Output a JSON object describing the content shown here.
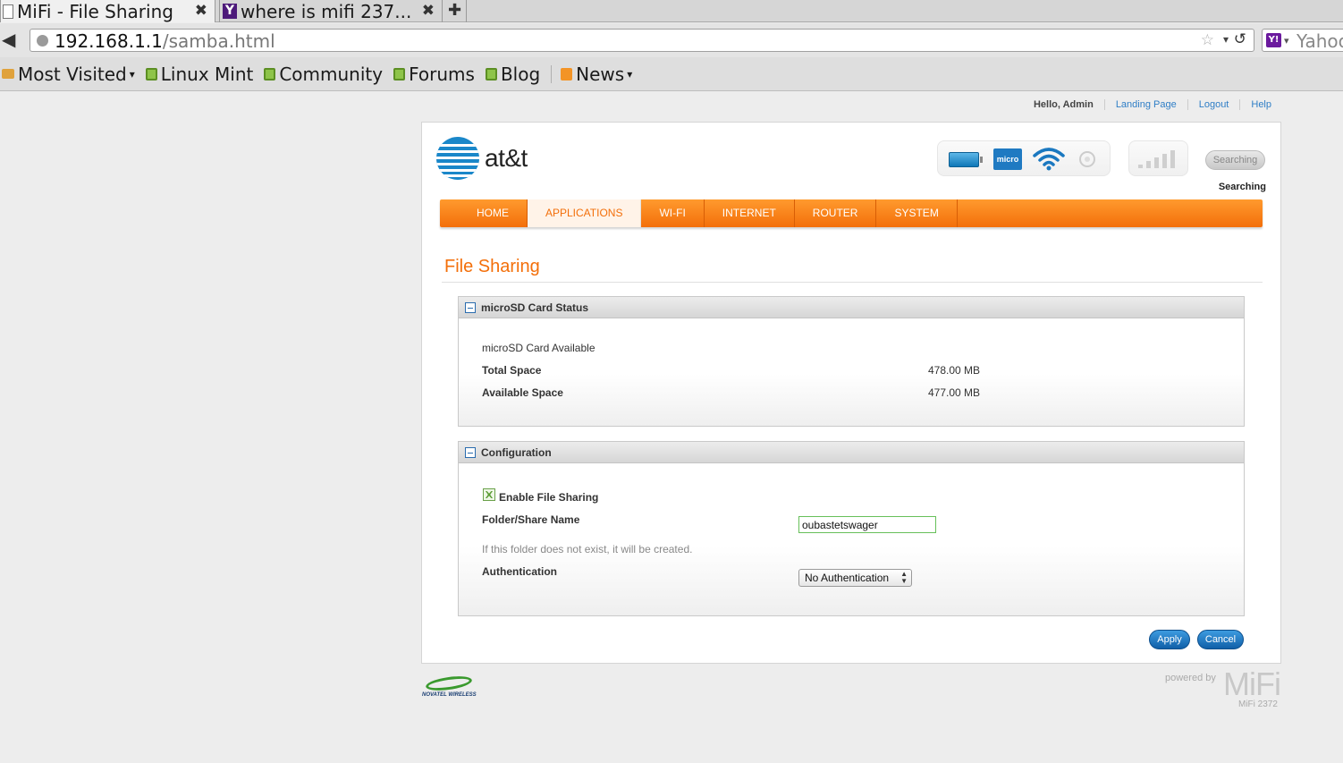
{
  "browser": {
    "tabs": [
      {
        "title": "MiFi - File Sharing",
        "close": "✖",
        "active": true
      },
      {
        "title": "where is mifi 237...",
        "close": "✖",
        "active": false,
        "favicon": "Y"
      }
    ],
    "new_tab": "✚",
    "back": "◀",
    "url_host": "192.168.1.1",
    "url_path": "/samba.html",
    "star": "☆",
    "url_dropdown": "▾",
    "reload": "↺",
    "search_engine_icon": "Y!",
    "search_dropdown": "▾",
    "search_text": "Yahoo"
  },
  "bookmarks": [
    {
      "label": "Most Visited",
      "icon": "folder-icon",
      "caret": "▾"
    },
    {
      "label": "Linux Mint",
      "icon": "mint-icon"
    },
    {
      "label": "Community",
      "icon": "mint-icon"
    },
    {
      "label": "Forums",
      "icon": "mint-icon"
    },
    {
      "label": "Blog",
      "icon": "mint-icon"
    },
    {
      "label": "News",
      "icon": "rss-icon",
      "caret": "▾"
    }
  ],
  "header": {
    "greeting": "Hello, Admin",
    "links": [
      "Landing Page",
      "Logout",
      "Help"
    ],
    "brand": "at&t",
    "sd_icon_text": "micro",
    "searching_button": "Searching",
    "searching_label": "Searching"
  },
  "nav": [
    "HOME",
    "APPLICATIONS",
    "WI-FI",
    "INTERNET",
    "ROUTER",
    "SYSTEM"
  ],
  "nav_active": "APPLICATIONS",
  "page_title": "File Sharing",
  "sd_status": {
    "title": "microSD Card Status",
    "availability": "microSD Card Available",
    "total_label": "Total Space",
    "total_value": "478.00 MB",
    "available_label": "Available Space",
    "available_value": "477.00 MB"
  },
  "configuration": {
    "title": "Configuration",
    "enable_label": "Enable File Sharing",
    "enable_checked": true,
    "folder_label": "Folder/Share Name",
    "folder_value": "oubastetswager",
    "folder_hint": "If this folder does not exist, it will be created.",
    "auth_label": "Authentication",
    "auth_value": "No Authentication"
  },
  "buttons": {
    "apply": "Apply",
    "cancel": "Cancel"
  },
  "footer": {
    "novatel": "NOVATEL WIRELESS",
    "powered_by": "powered by",
    "mifi": "MiFi",
    "model": "MiFi 2372"
  },
  "colors": {
    "accent_orange": "#f36f0a",
    "link_blue": "#2f7ec6",
    "button_blue": "#1a6fb8",
    "att_blue": "#1a87c9"
  }
}
